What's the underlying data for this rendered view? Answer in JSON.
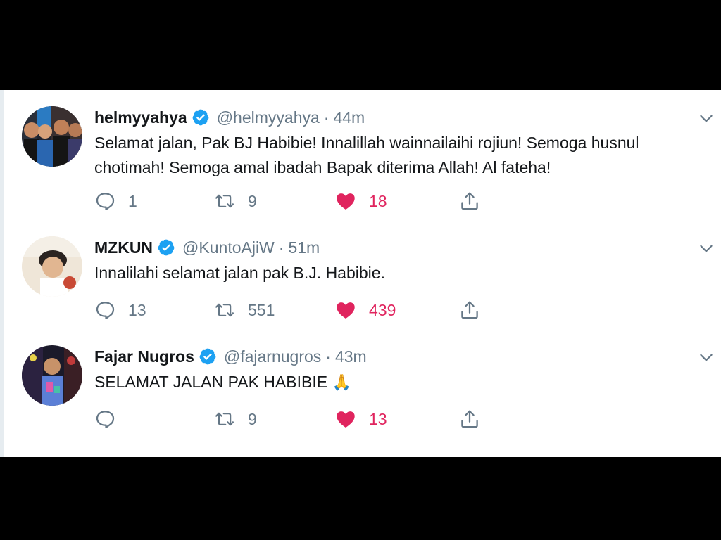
{
  "tweets": [
    {
      "name": "helmyyahya",
      "handle": "@helmyyahya",
      "separator": "·",
      "time": "44m",
      "text": "Selamat jalan, Pak BJ Habibie! Innalillah wainnailaihi rojiun! Semoga husnul chotimah! Semoga amal ibadah Bapak diterima Allah! Al fateha!",
      "replies": "1",
      "retweets": "9",
      "likes": "18",
      "verified": true,
      "liked": true
    },
    {
      "name": "MZKUN",
      "handle": "@KuntoAjiW",
      "separator": "·",
      "time": "51m",
      "text": "Innalilahi selamat jalan pak B.J. Habibie.",
      "replies": "13",
      "retweets": "551",
      "likes": "439",
      "verified": true,
      "liked": true
    },
    {
      "name": "Fajar Nugros",
      "handle": "@fajarnugros",
      "separator": "·",
      "time": "43m",
      "text": "SELAMAT JALAN PAK HABIBIE",
      "emoji": "🙏",
      "replies": "",
      "retweets": "9",
      "likes": "13",
      "verified": true,
      "liked": true
    }
  ],
  "colors": {
    "name": "#14171a",
    "secondary": "#657786",
    "verified": "#1da1f2",
    "like": "#e0245e",
    "divider": "#e6ecf0"
  },
  "icons": [
    "verified-badge-icon",
    "chevron-down-icon",
    "reply-icon",
    "retweet-icon",
    "heart-icon",
    "share-icon"
  ]
}
